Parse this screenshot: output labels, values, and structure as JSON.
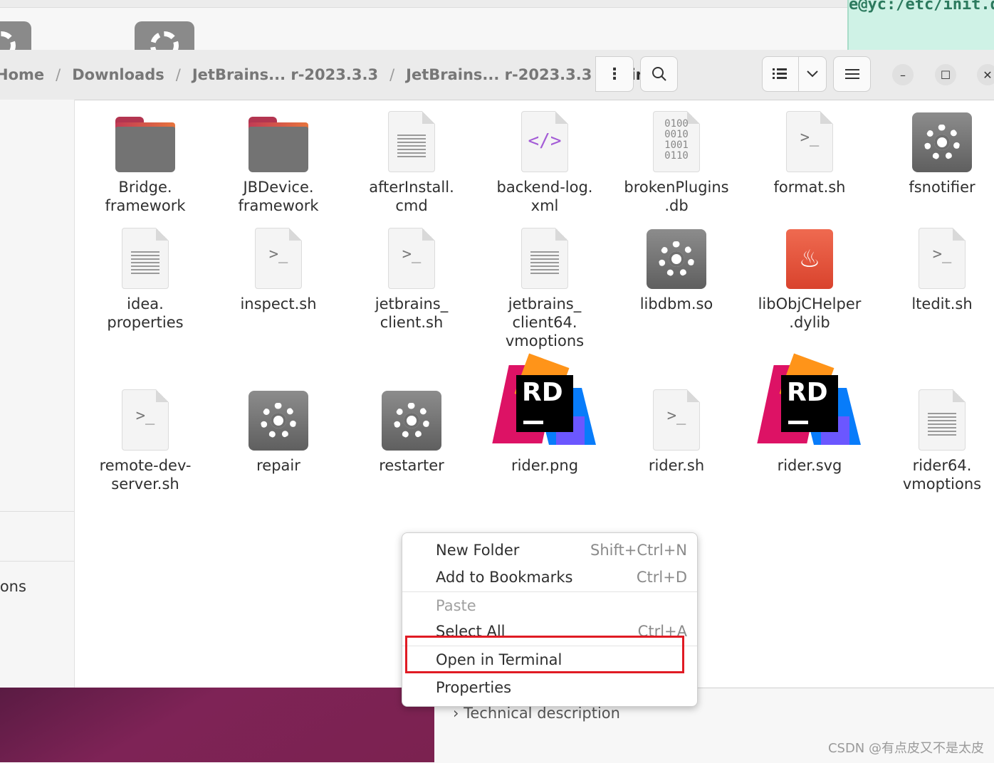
{
  "terminal_strip": {
    "text": "e@yc:/etc/init.d"
  },
  "breadcrumb": {
    "items": [
      "Home",
      "Downloads",
      "JetBrains... r-2023.3.3",
      "JetBrains... r-2023.3.3"
    ],
    "current": "bin",
    "separator": "/"
  },
  "toolbar": {
    "more_icon": "⋮",
    "window_controls": {
      "minimize": "–",
      "maximize": "☐",
      "close": "✕"
    }
  },
  "sidebar": {
    "partial_label": "ions"
  },
  "files": [
    {
      "name": "Bridge.\nframework",
      "icon": "folder-icon"
    },
    {
      "name": "JBDevice.\nframework",
      "icon": "folder-icon"
    },
    {
      "name": "afterInstall.\ncmd",
      "icon": "text-file-icon"
    },
    {
      "name": "backend-log.\nxml",
      "icon": "xml-file-icon",
      "glyph": "</>"
    },
    {
      "name": "brokenPlugins\n.db",
      "icon": "binary-file-icon",
      "glyph": "0100\n0010\n1001\n0110"
    },
    {
      "name": "format.sh",
      "icon": "script-file-icon",
      "glyph": ">_"
    },
    {
      "name": "fsnotifier",
      "icon": "executable-gear-icon"
    },
    {
      "name": "idea.\nproperties",
      "icon": "text-file-icon"
    },
    {
      "name": "inspect.sh",
      "icon": "script-file-icon",
      "glyph": ">_"
    },
    {
      "name": "jetbrains_\nclient.sh",
      "icon": "script-file-icon",
      "glyph": ">_"
    },
    {
      "name": "jetbrains_\nclient64.\nvmoptions",
      "icon": "text-file-icon"
    },
    {
      "name": "libdbm.so",
      "icon": "executable-gear-icon"
    },
    {
      "name": "libObjCHelper\n.dylib",
      "icon": "java-icon",
      "glyph": "♨"
    },
    {
      "name": "ltedit.sh",
      "icon": "script-file-icon",
      "glyph": ">_"
    },
    {
      "name": "remote-dev-\nserver.sh",
      "icon": "script-file-icon",
      "glyph": ">_"
    },
    {
      "name": "repair",
      "icon": "executable-gear-icon"
    },
    {
      "name": "restarter",
      "icon": "executable-gear-icon"
    },
    {
      "name": "rider.png",
      "icon": "rider-logo-icon",
      "glyph": "RD"
    },
    {
      "name": "rider.sh",
      "icon": "script-file-icon",
      "glyph": ">_"
    },
    {
      "name": "rider.svg",
      "icon": "rider-logo-icon",
      "glyph": "RD"
    },
    {
      "name": "rider64.\nvmoptions",
      "icon": "text-file-icon"
    }
  ],
  "context_menu": {
    "items": [
      {
        "label": "New Folder",
        "accel": "Shift+Ctrl+N",
        "enabled": true
      },
      {
        "label": "Add to Bookmarks",
        "accel": "Ctrl+D",
        "enabled": true
      },
      {
        "label": "Paste",
        "accel": "",
        "enabled": false
      },
      {
        "label": "Select All",
        "accel": "Ctrl+A",
        "enabled": true
      },
      {
        "label": "Open in Terminal",
        "accel": "",
        "enabled": true,
        "highlighted": true
      },
      {
        "label": "Properties",
        "accel": "",
        "enabled": true
      }
    ]
  },
  "bottom": {
    "technical_description": "Technical description",
    "watermark": "CSDN @有点皮又不是太皮"
  },
  "colors": {
    "highlight_box": "#e01b24",
    "folder_accent": "#e7743d",
    "desktop_bg": "#7e2356",
    "terminal_bg": "#cff2e6"
  }
}
